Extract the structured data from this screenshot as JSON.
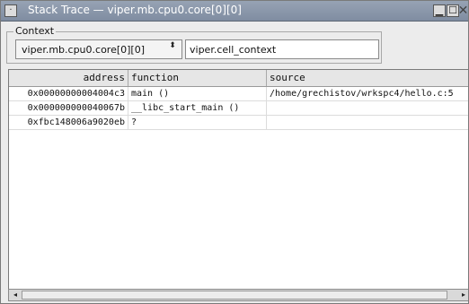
{
  "window": {
    "title": "Stack Trace — viper.mb.cpu0.core[0][0]",
    "menu_glyph": "·",
    "minimize_glyph": "▁",
    "maximize_glyph": "☐",
    "close_glyph": "✕"
  },
  "context": {
    "label": "Context",
    "selected_core": "viper.mb.cpu0.core[0][0]",
    "combo_arrow": "⬍",
    "cell_context": "viper.cell_context"
  },
  "table": {
    "headers": {
      "address": "address",
      "function": "function",
      "source": "source"
    },
    "rows": [
      {
        "address": "0x00000000004004c3",
        "function": "main ()",
        "source": "/home/grechistov/wrkspc4/hello.c:5"
      },
      {
        "address": "0x000000000040067b",
        "function": "__libc_start_main ()",
        "source": ""
      },
      {
        "address": "0xfbc148006a9020eb",
        "function": "?",
        "source": ""
      }
    ]
  },
  "scrollbar": {
    "left_arrow": "◂",
    "right_arrow": "▸"
  }
}
